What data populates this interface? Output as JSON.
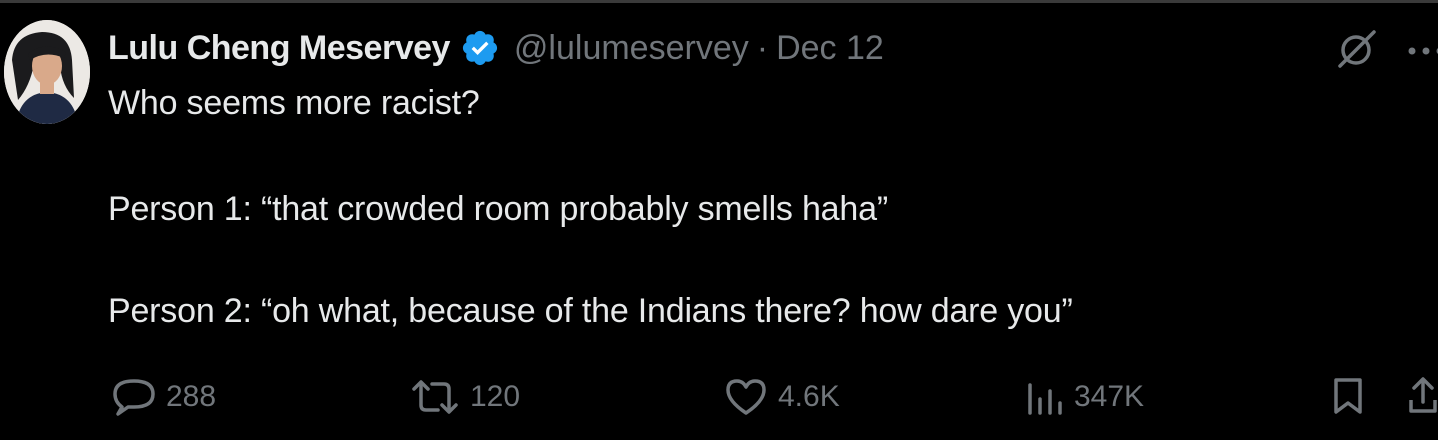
{
  "tweet": {
    "author": {
      "display_name": "Lulu Cheng Meservey",
      "handle": "@lulumeservey",
      "verified": true
    },
    "date": "Dec 12",
    "separator": "·",
    "lines": [
      "Who seems more racist?",
      "Person 1: “that crowded room probably smells haha”",
      "Person 2: “oh what, because of the Indians there? how dare you”"
    ],
    "stats": {
      "replies": "288",
      "reposts": "120",
      "likes": "4.6K",
      "views": "347K"
    }
  },
  "icons": {
    "verified": "verified-badge-icon",
    "grok": "grok-icon",
    "more": "more-options-icon",
    "reply": "reply-icon",
    "repost": "repost-icon",
    "like": "heart-icon",
    "views": "views-bar-chart-icon",
    "bookmark": "bookmark-icon",
    "share": "share-icon"
  },
  "colors": {
    "background": "#000000",
    "text": "#e7e9ea",
    "muted": "#71767b",
    "verified": "#1d9bf0"
  }
}
